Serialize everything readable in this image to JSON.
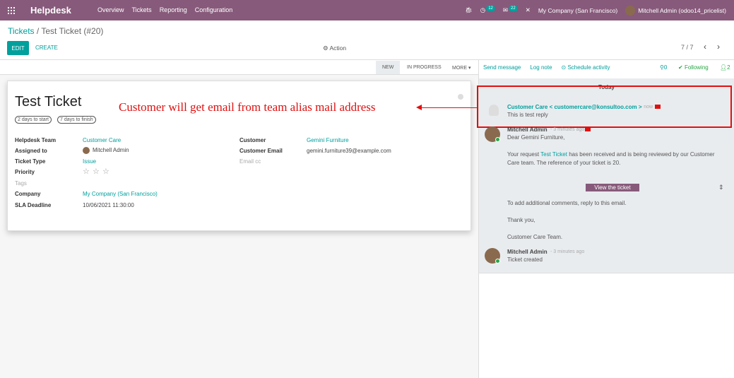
{
  "navbar": {
    "brand": "Helpdesk",
    "menu": [
      "Overview",
      "Tickets",
      "Reporting",
      "Configuration"
    ],
    "activity_count": "12",
    "messages_count": "22",
    "company": "My Company (San Francisco)",
    "user": "Mitchell Admin (odoo14_pricelist)"
  },
  "breadcrumb": {
    "parent": "Tickets",
    "current": "Test Ticket (#20)"
  },
  "controls": {
    "edit": "EDIT",
    "create": "CREATE",
    "action": "Action",
    "pager": "7 / 7"
  },
  "statusbar": {
    "stages": [
      "NEW",
      "IN PROGRESS",
      "MORE"
    ],
    "active": "NEW"
  },
  "ticket": {
    "title": "Test Ticket",
    "sla_start": "2 days to start",
    "sla_finish": "7 days to finish",
    "left": [
      {
        "label": "Helpdesk Team",
        "value": "Customer Care"
      },
      {
        "label": "Assigned to",
        "value": "Mitchell Admin"
      },
      {
        "label": "Ticket Type",
        "value": "Issue"
      },
      {
        "label": "Priority",
        "value": ""
      },
      {
        "label": "Tags",
        "value": ""
      },
      {
        "label": "Company",
        "value": "My Company (San Francisco)"
      },
      {
        "label": "SLA Deadline",
        "value": "10/06/2021 11:30:00"
      }
    ],
    "right": [
      {
        "label": "Customer",
        "value": "Gemini Furniture"
      },
      {
        "label": "Customer Email",
        "value": "gemini.furniture39@example.com"
      },
      {
        "label": "Email cc",
        "value": ""
      }
    ]
  },
  "annotation": "Customer will get email from team alias mail address",
  "chatter": {
    "send_message": "Send message",
    "log_note": "Log note",
    "schedule": "Schedule activity",
    "attachments": "0",
    "following": "Following",
    "followers": "2",
    "today": "Today",
    "messages": [
      {
        "author": "Customer Care < customercare@konsultoo.com >",
        "date": "- now",
        "body": [
          "This is test reply"
        ]
      },
      {
        "author": "Mitchell Admin",
        "date": "- 3 minutes ago",
        "body": [
          "Dear Gemini Furniture,",
          "Your request",
          "Test Ticket",
          "has been received and is being reviewed by our Customer",
          "Care team. The reference of your ticket is 20.",
          "To add additional comments, reply to this email.",
          "Thank you,",
          "Customer Care Team."
        ],
        "button": "View the ticket"
      },
      {
        "author": "Mitchell Admin",
        "date": "- 3 minutes ago",
        "body": [
          "Ticket created"
        ]
      }
    ]
  }
}
